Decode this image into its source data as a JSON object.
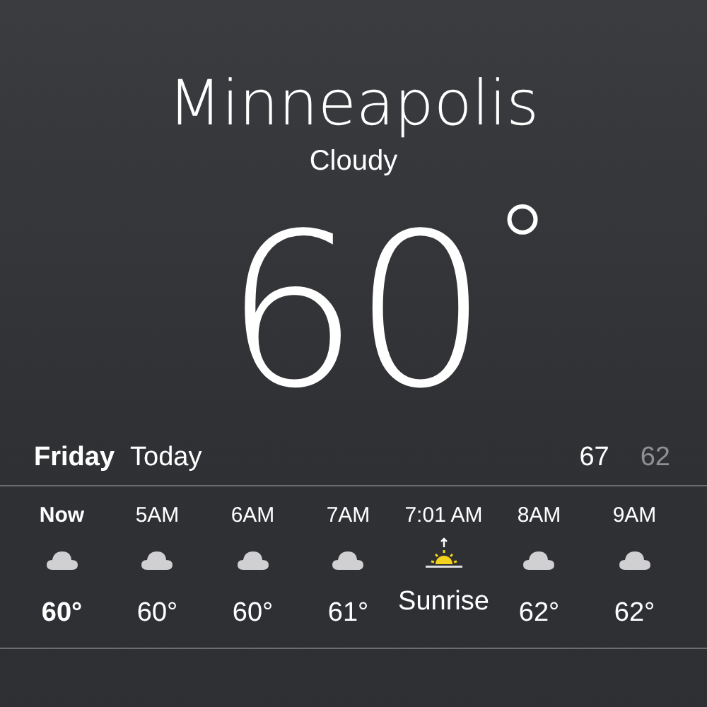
{
  "location": {
    "city": "Minneapolis",
    "condition": "Cloudy",
    "temperature": "60",
    "degree": "°"
  },
  "day": {
    "weekday": "Friday",
    "label": "Today",
    "high": "67",
    "low": "62"
  },
  "hourly": [
    {
      "time": "Now",
      "kind": "cloud",
      "value": "60°",
      "current": true
    },
    {
      "time": "5AM",
      "kind": "cloud",
      "value": "60°",
      "current": false
    },
    {
      "time": "6AM",
      "kind": "cloud",
      "value": "60°",
      "current": false
    },
    {
      "time": "7AM",
      "kind": "cloud",
      "value": "61°",
      "current": false
    },
    {
      "time": "7:01 AM",
      "kind": "sunrise",
      "value": "Sunrise",
      "current": false
    },
    {
      "time": "8AM",
      "kind": "cloud",
      "value": "62°",
      "current": false
    },
    {
      "time": "9AM",
      "kind": "cloud",
      "value": "62°",
      "current": false
    }
  ]
}
